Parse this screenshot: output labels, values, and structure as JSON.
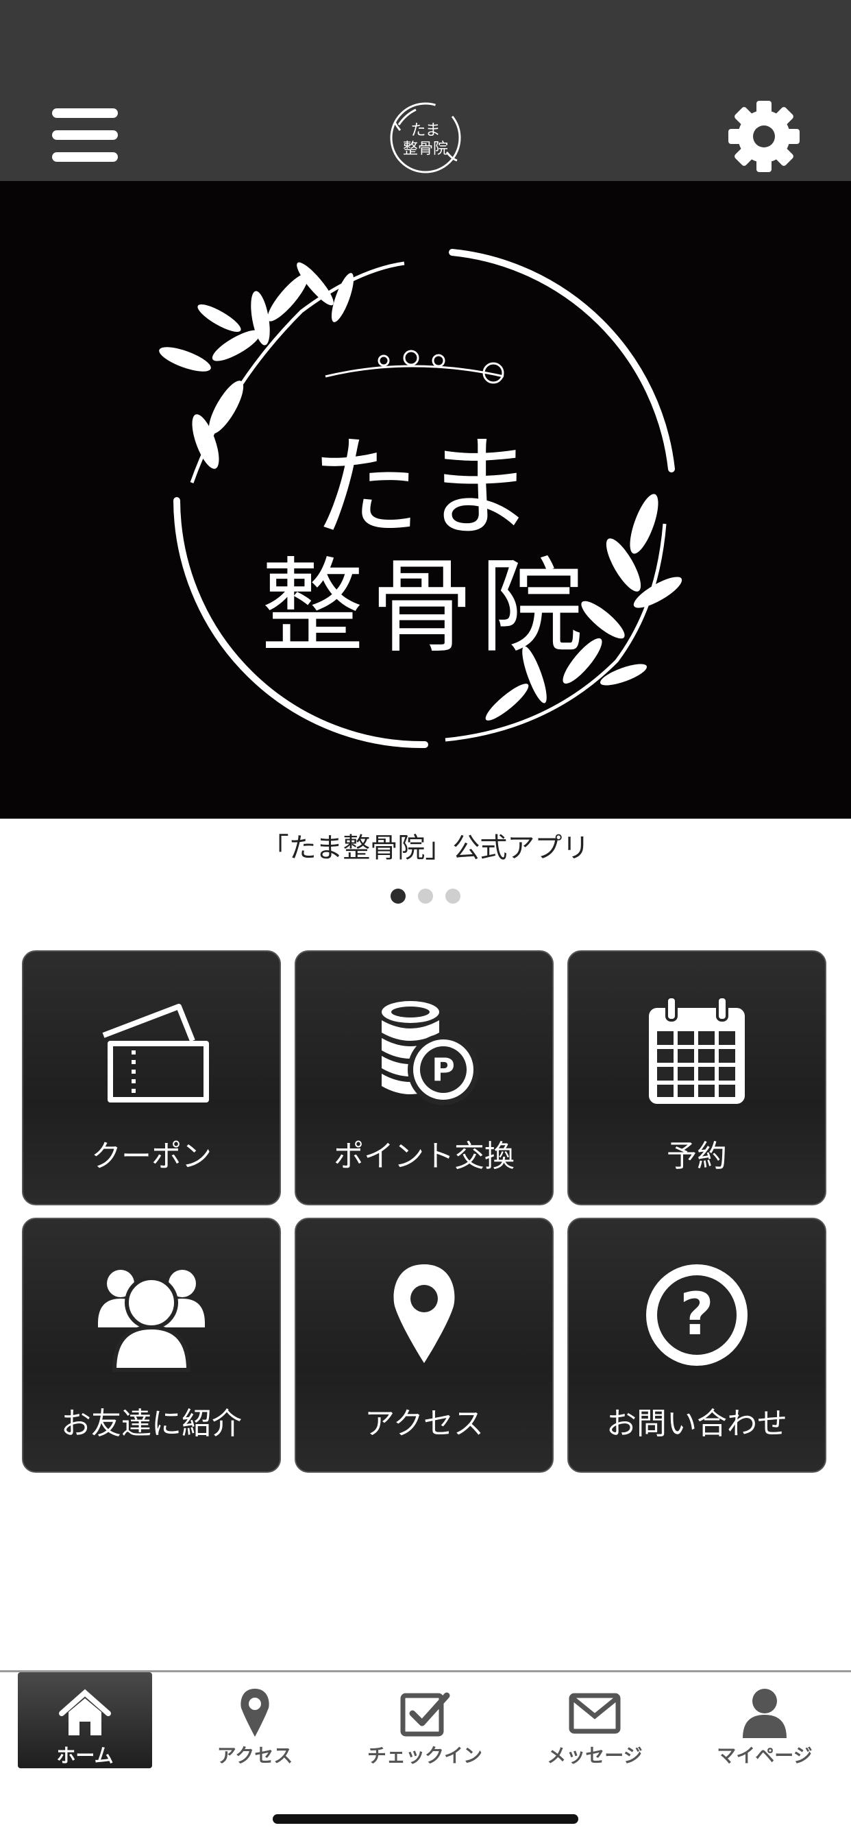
{
  "header": {
    "menu_icon": "hamburger-menu-icon",
    "logo_text": "たま整骨院",
    "settings_icon": "gear-icon"
  },
  "banner": {
    "title_line1": "たま",
    "title_line2": "整骨院"
  },
  "caption": "「たま整骨院」公式アプリ",
  "carousel": {
    "pages": 3,
    "active_index": 0
  },
  "tiles": [
    {
      "label": "クーポン",
      "icon": "coupon-ticket-icon"
    },
    {
      "label": "ポイント交換",
      "icon": "point-coins-icon"
    },
    {
      "label": "予約",
      "icon": "calendar-icon"
    },
    {
      "label": "お友達に紹介",
      "icon": "group-users-icon"
    },
    {
      "label": "アクセス",
      "icon": "map-pin-icon"
    },
    {
      "label": "お問い合わせ",
      "icon": "question-circle-icon"
    }
  ],
  "tabbar": {
    "items": [
      {
        "label": "ホーム",
        "icon": "home-icon",
        "active": true
      },
      {
        "label": "アクセス",
        "icon": "map-pin-icon",
        "active": false
      },
      {
        "label": "チェックイン",
        "icon": "checkbox-icon",
        "active": false
      },
      {
        "label": "メッセージ",
        "icon": "envelope-icon",
        "active": false
      },
      {
        "label": "マイページ",
        "icon": "user-icon",
        "active": false
      }
    ]
  },
  "colors": {
    "header_bg": "#3a3a3a",
    "banner_bg": "#060404",
    "tile_bg": "#262626",
    "active_tab_bg": "#2a2a2a"
  }
}
